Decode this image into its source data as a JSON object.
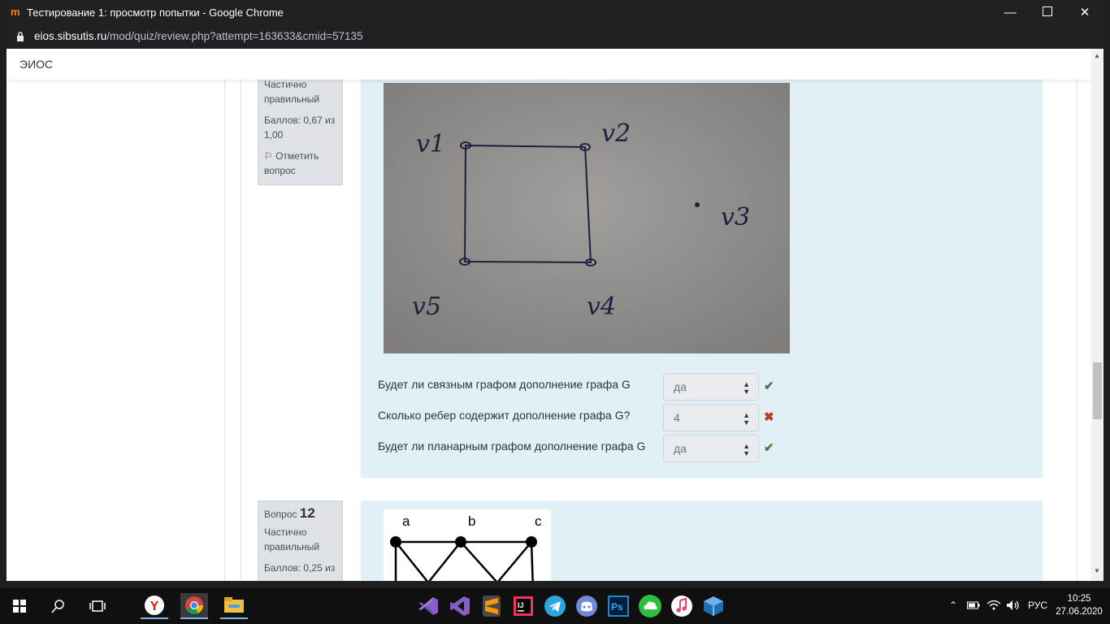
{
  "window": {
    "title": "Тестирование 1: просмотр попытки - Google Chrome",
    "minimize": "—",
    "close": "✕"
  },
  "address": {
    "host": "eios.sibsutis.ru",
    "path": "/mod/quiz/review.php?attempt=163633&cmid=57135"
  },
  "site": {
    "brand": "ЭИОС"
  },
  "question11": {
    "state": "Частично правильный",
    "grade": "Баллов: 0,67 из 1,00",
    "flag": "Отметить вопрос",
    "image_labels": {
      "v1": "v1",
      "v2": "v2",
      "v3": "v3",
      "v4": "v4",
      "v5": "v5"
    },
    "rows": [
      {
        "text": "Будет ли связным графом дополнение графа G",
        "answer": "да",
        "result": "correct"
      },
      {
        "text": "Сколько ребер содержит дополнение графа G?",
        "answer": "4",
        "result": "incorrect"
      },
      {
        "text": "Будет ли планарным графом дополнение графа G",
        "answer": "да",
        "result": "correct"
      }
    ]
  },
  "question12": {
    "label": "Вопрос",
    "number": "12",
    "state": "Частично правильный",
    "grade": "Баллов: 0,25 из",
    "vertices": [
      "a",
      "b",
      "c"
    ]
  },
  "taskbar": {
    "language": "РУС",
    "time": "10:25",
    "date": "27.06.2020",
    "apps": [
      "start-icon",
      "search-icon",
      "task-view-icon",
      "yandex-browser-icon",
      "chrome-icon",
      "file-explorer-icon",
      "visual-studio-code-icon",
      "visual-studio-icon",
      "sublime-text-icon",
      "intellij-idea-icon",
      "telegram-icon",
      "discord-icon",
      "photoshop-icon",
      "cloud-sync-icon",
      "itunes-icon",
      "virtualbox-icon"
    ]
  }
}
